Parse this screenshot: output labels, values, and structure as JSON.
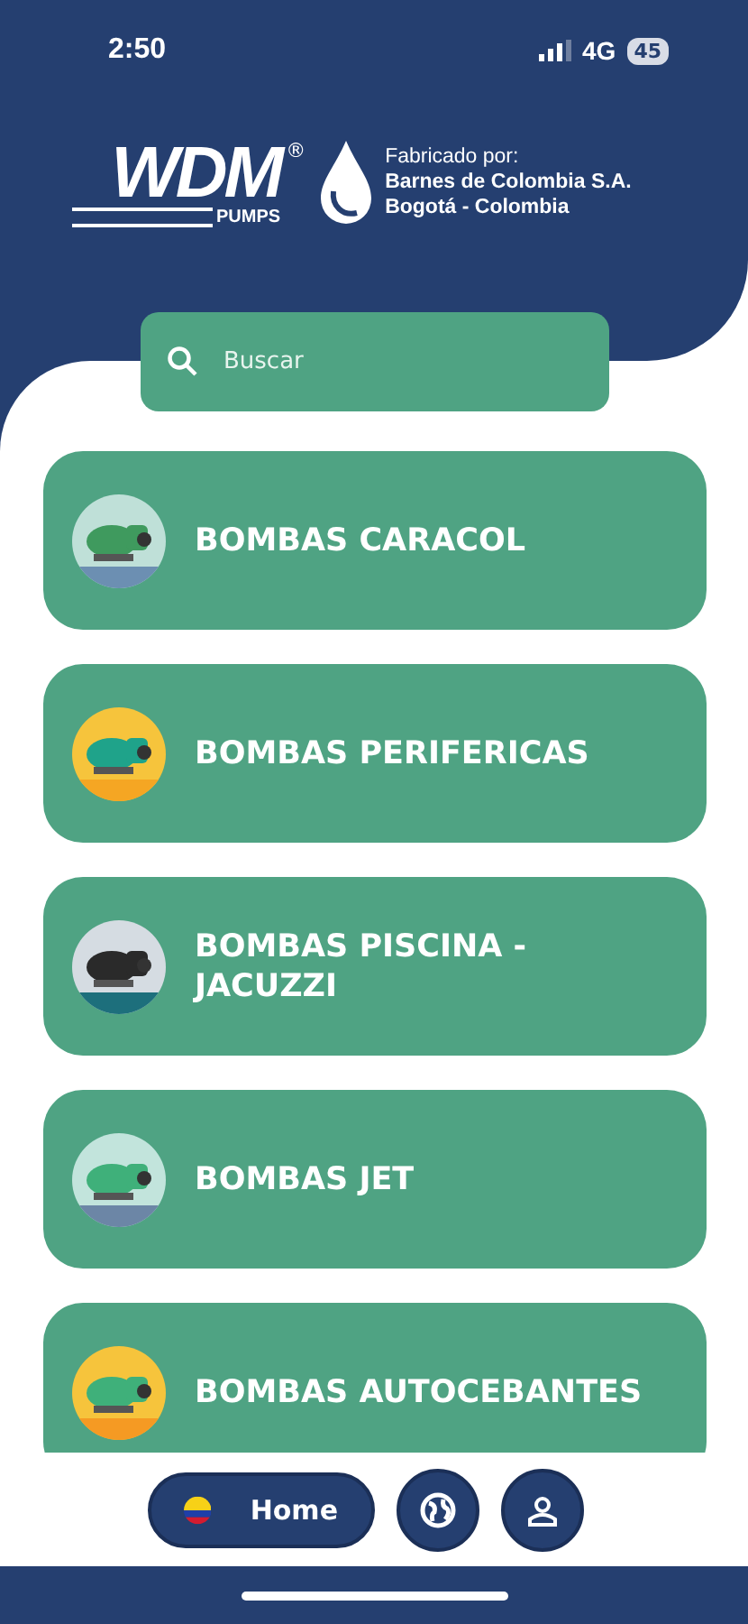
{
  "status_bar": {
    "time": "2:50",
    "network": "4G",
    "battery": "45"
  },
  "header": {
    "logo": {
      "mark": "WDM",
      "registered": "®",
      "sub": "PUMPS"
    },
    "maker": {
      "label": "Fabricado por:",
      "company": "Barnes de Colombia S.A.",
      "city": "Bogotá - Colombia"
    }
  },
  "search": {
    "placeholder": "Buscar"
  },
  "categories": [
    {
      "label": "BOMBAS CARACOL",
      "kind": "picture"
    },
    {
      "label": "BOMBAS PERIFERICAS",
      "kind": "picture"
    },
    {
      "label": "BOMBAS PISCINA - JACUZZI",
      "kind": "picture"
    },
    {
      "label": "BOMBAS JET",
      "kind": "picture"
    },
    {
      "label": "BOMBAS AUTOCEBANTES",
      "kind": "picture"
    }
  ],
  "bottom_nav": {
    "home": "Home"
  }
}
